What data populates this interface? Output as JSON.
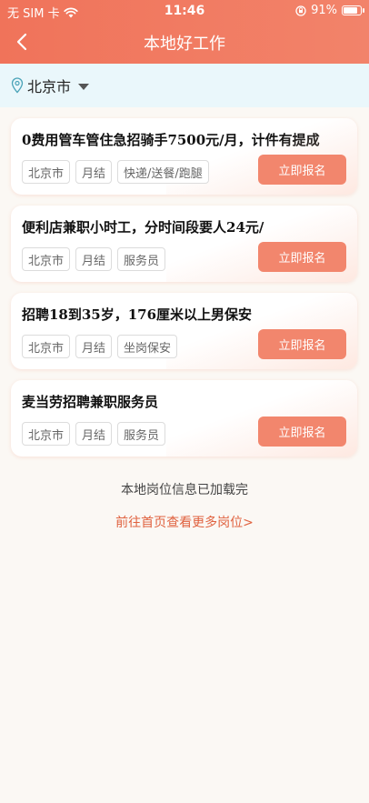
{
  "status_bar": {
    "carrier": "无 SIM 卡",
    "time": "11:46",
    "battery_percent": "91%",
    "battery_level": 0.91
  },
  "navbar": {
    "title": "本地好工作"
  },
  "city": {
    "name": "北京市"
  },
  "jobs": [
    {
      "title": "0费用管车管住急招骑手7500元/月，计件有提成",
      "tags": [
        "北京市",
        "月结",
        "快递/送餐/跑腿"
      ],
      "apply_label": "立即报名"
    },
    {
      "title": "便利店兼职小时工，分时间段要人24元/",
      "tags": [
        "北京市",
        "月结",
        "服务员"
      ],
      "apply_label": "立即报名"
    },
    {
      "title": "招聘18到35岁，176厘米以上男保安",
      "tags": [
        "北京市",
        "月结",
        "坐岗保安"
      ],
      "apply_label": "立即报名"
    },
    {
      "title": "麦当劳招聘兼职服务员",
      "tags": [
        "北京市",
        "月结",
        "服务员"
      ],
      "apply_label": "立即报名"
    }
  ],
  "footer": {
    "note": "本地岗位信息已加载完",
    "link": "前往首页查看更多岗位>"
  },
  "colors": {
    "header": "#f0735a",
    "accent_button": "#f2866d",
    "link": "#e0623f",
    "city_bar": "#eaf7fb"
  }
}
